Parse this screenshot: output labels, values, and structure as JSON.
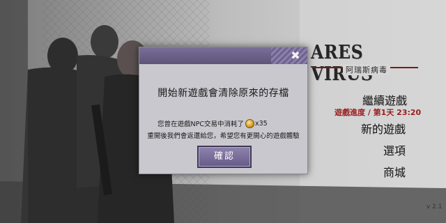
{
  "logo": {
    "title": "ARES VIRUS",
    "subtitle": "阿瑞斯病毒"
  },
  "menu": {
    "continue_label": "繼續遊戲",
    "progress_label": "遊戲進度 / 第1天 23:20",
    "new_game_label": "新的遊戲",
    "options_label": "選項",
    "shop_label": "商城"
  },
  "version": "v 2.1",
  "dialog": {
    "close_icon": "close-x-icon",
    "title": "開始新遊戲會清除原來的存檔",
    "line1_prefix": "您曾在遊戲NPC交易中消耗了",
    "line1_suffix": "x35",
    "coin_icon": "gold-coin-icon",
    "line2": "重開後我們會返還給您，希望您有更開心的遊戲體驗",
    "confirm_label": "確認"
  },
  "colors": {
    "dialog_bg": "#c9c8cf",
    "header_purple": "#6c6290",
    "button_purple": "#7a6f9c",
    "progress_red": "#9a1d1d"
  }
}
